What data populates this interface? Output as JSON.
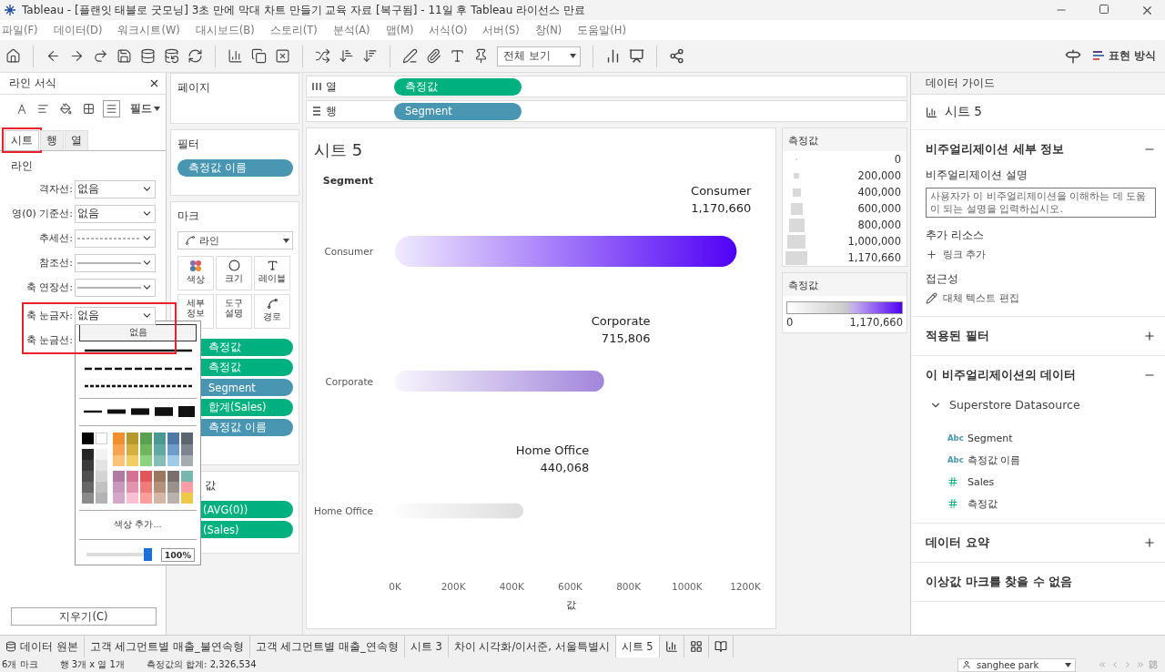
{
  "window": {
    "title": "Tableau - [플랜잇 태블로 굿모닝] 3초 만에 막대 차트 만들기 교육 자료 [복구됨] - 11일 후 Tableau 라이선스 만료"
  },
  "menu": [
    "파일(F)",
    "데이터(D)",
    "워크시트(W)",
    "대시보드(B)",
    "스토리(T)",
    "분석(A)",
    "맵(M)",
    "서식(O)",
    "서버(S)",
    "창(N)",
    "도움말(H)"
  ],
  "toolbar": {
    "fit": "전체 보기",
    "show_me": "표현 방식"
  },
  "format_pane": {
    "title": "라인 서식",
    "fields_button": "필드",
    "tabs": [
      {
        "label": "시트",
        "selected": true,
        "highlighted": true
      },
      {
        "label": "행",
        "selected": false,
        "highlighted": false
      },
      {
        "label": "열",
        "selected": false,
        "highlighted": false
      }
    ],
    "section": "라인",
    "rows": [
      {
        "label": "격자선:",
        "kind": "text",
        "value": "없음",
        "highlighted": false
      },
      {
        "label": "영(0) 기준선:",
        "kind": "text",
        "value": "없음",
        "highlighted": false
      },
      {
        "label": "추세선:",
        "kind": "dashed",
        "highlighted": false
      },
      {
        "label": "참조선:",
        "kind": "solid",
        "highlighted": false
      },
      {
        "label": "축 연장선:",
        "kind": "solid",
        "highlighted": false
      },
      {
        "label": "축 눈금자:",
        "kind": "text",
        "value": "없음",
        "highlighted": true
      },
      {
        "label": "축 눈금선:",
        "kind": "covered",
        "highlighted": true
      }
    ],
    "clear_button": "지우기(C)"
  },
  "line_popup": {
    "options": [
      {
        "kind": "text",
        "label": "없음",
        "selected": true
      },
      {
        "kind": "solid",
        "selected": false
      },
      {
        "kind": "dashed",
        "selected": false
      },
      {
        "kind": "dotted",
        "selected": false
      }
    ],
    "palette": [
      {
        "colors": [
          {
            "color": "#000000"
          },
          {
            "color": "#262626"
          },
          {
            "color": "#3b3b3b"
          },
          {
            "color": "#4f4f4f"
          },
          {
            "color": "#666666"
          },
          {
            "color": "#8a8a8a"
          }
        ]
      },
      {
        "colors": [
          {
            "color": "#ffffff"
          },
          {
            "color": "#f2f2f2"
          },
          {
            "color": "#e3e3e3"
          },
          {
            "color": "#d4d4d4"
          },
          {
            "color": "#c2c2c2"
          },
          {
            "color": "#b3b3b3"
          }
        ]
      },
      {
        "colors": [
          {
            "color": "#f28e2b"
          },
          {
            "color": "#f8a553"
          },
          {
            "color": "#fcc27a"
          },
          {
            "color": "#b07aa1"
          },
          {
            "color": "#c897be"
          },
          {
            "color": "#d4a6c8"
          }
        ]
      },
      {
        "colors": [
          {
            "color": "#b6992d"
          },
          {
            "color": "#d4b13e"
          },
          {
            "color": "#f1ce63"
          },
          {
            "color": "#d37295"
          },
          {
            "color": "#e393ad"
          },
          {
            "color": "#fabfd2"
          }
        ]
      },
      {
        "colors": [
          {
            "color": "#59a14f"
          },
          {
            "color": "#6fb65c"
          },
          {
            "color": "#8cd17d"
          },
          {
            "color": "#e15759"
          },
          {
            "color": "#ef7b7b"
          },
          {
            "color": "#ff9d9a"
          }
        ]
      },
      {
        "colors": [
          {
            "color": "#499894"
          },
          {
            "color": "#5fa9a2"
          },
          {
            "color": "#86bcb6"
          },
          {
            "color": "#9d7660"
          },
          {
            "color": "#b5917b"
          },
          {
            "color": "#d7b5a6"
          }
        ]
      },
      {
        "colors": [
          {
            "color": "#4e79a7"
          },
          {
            "color": "#6f9ccb"
          },
          {
            "color": "#a0cbe8"
          },
          {
            "color": "#79706e"
          },
          {
            "color": "#9a908c"
          },
          {
            "color": "#bab0ac"
          }
        ]
      },
      {
        "colors": [
          {
            "color": "#5b6570"
          },
          {
            "color": "#7b848f"
          },
          {
            "color": "#a5acaf"
          },
          {
            "color": "#76b7b2"
          },
          {
            "color": "#ff9da7"
          },
          {
            "color": "#edc948"
          }
        ]
      }
    ],
    "add_color": "색상 추가...",
    "opacity": {
      "level": 1,
      "reading": "100%"
    }
  },
  "pages": {
    "title": "페이지"
  },
  "filters": {
    "title": "필터",
    "pills": [
      {
        "label": "측정값 이름",
        "kind": "dimension"
      }
    ]
  },
  "marks": {
    "title": "마크",
    "mark_type": "라인",
    "buttons": [
      {
        "label": "색상",
        "kind": "color"
      },
      {
        "label": "크기",
        "kind": "size"
      },
      {
        "label": "레이블",
        "kind": "label"
      },
      {
        "label": "세부 정보",
        "kind": "detail"
      },
      {
        "label": "도구 설명",
        "kind": "tooltip"
      },
      {
        "label": "경로",
        "kind": "path"
      }
    ],
    "pills": [
      {
        "label": "측정값",
        "kind": "measure"
      },
      {
        "label": "측정값",
        "kind": "measure"
      },
      {
        "label": "Segment",
        "kind": "dimension"
      },
      {
        "label": "합계(Sales)",
        "kind": "measure"
      },
      {
        "label": "측정값 이름",
        "kind": "dimension"
      }
    ]
  },
  "measure_values": {
    "title": "값",
    "pills": [
      {
        "label": "(AVG(0))",
        "kind": "measure"
      },
      {
        "label": "(Sales)",
        "kind": "measure"
      }
    ]
  },
  "columns_shelf": {
    "label": "열",
    "pills": [
      {
        "label": "측정값",
        "kind": "measure"
      }
    ]
  },
  "rows_shelf": {
    "label": "행",
    "pills": [
      {
        "label": "Segment",
        "kind": "dimension"
      }
    ]
  },
  "view": {
    "title": "시트 5",
    "chart_data": {
      "type": "bar",
      "orientation": "horizontal",
      "ylabel": "Segment",
      "xlabel": "값",
      "categories": [
        "Consumer",
        "Corporate",
        "Home Office"
      ],
      "values": [
        1170000,
        716000,
        440000
      ],
      "xlim": [
        0,
        1200000
      ],
      "xticks": [
        {
          "value": 0,
          "label": "0K"
        },
        {
          "value": 200000,
          "label": "200K"
        },
        {
          "value": 400000,
          "label": "400K"
        },
        {
          "value": 600000,
          "label": "600K"
        },
        {
          "value": 800000,
          "label": "800K"
        },
        {
          "value": 1000000,
          "label": "1000K"
        },
        {
          "value": 1200000,
          "label": "1200K"
        }
      ],
      "value_labels": [
        {
          "name": "Consumer",
          "value": "1,170,660"
        },
        {
          "name": "Corporate",
          "value": "715,806"
        },
        {
          "name": "Home Office",
          "value": "440,068"
        }
      ]
    }
  },
  "size_legend": {
    "title": "측정값",
    "items": [
      "0",
      "200,000",
      "400,000",
      "600,000",
      "800,000",
      "1,000,000",
      "1,170,660"
    ]
  },
  "color_legend": {
    "title": "측정값",
    "min": "0",
    "max": "1,170,660"
  },
  "data_guide": {
    "title": "데이터 가이드",
    "sheet": "시트 5",
    "sections": [
      {
        "kind": "details",
        "title": "비주얼리제이션 세부 정보",
        "expanded": true,
        "desc_label": "비주얼리제이션 설명",
        "desc_placeholder": "사용자가 이 비주얼리제이션을 이해하는 데 도움이 되는 설명을 입력하십시오.",
        "resources_label": "추가 리소스",
        "add_link": "링크 추가",
        "access_label": "접근성",
        "alt_text": "대체 텍스트 편집"
      },
      {
        "kind": "plain",
        "title": "적용된 필터",
        "expanded": false
      },
      {
        "kind": "data",
        "title": "이 비주얼리제이션의 데이터",
        "expanded": true,
        "source": "Superstore Datasource",
        "fields": [
          {
            "kind": "string",
            "type_label": "Abc",
            "name": "Segment"
          },
          {
            "kind": "string",
            "type_label": "Abc",
            "name": "측정값 이름"
          },
          {
            "kind": "number",
            "name": "Sales"
          },
          {
            "kind": "number",
            "name": "측정값"
          }
        ]
      },
      {
        "kind": "plain",
        "title": "데이터 요약",
        "expanded": false
      },
      {
        "kind": "note",
        "title": "이상값 마크를 찾을 수 없음"
      }
    ]
  },
  "sheet_tabs": {
    "data_source": "데이터 원본",
    "sheets": [
      {
        "label": "고객 세그먼트별 매출_불연속형",
        "selected": false
      },
      {
        "label": "고객 세그먼트별 매출_연속형",
        "selected": false
      },
      {
        "label": "시트 3",
        "selected": false
      },
      {
        "label": "차이 시각화/이서준, 서울특별시",
        "selected": false
      },
      {
        "label": "시트 5",
        "selected": true
      }
    ]
  },
  "status_bar": {
    "marks": "6개 마크",
    "shape": "행 3개 x 열 1개",
    "sum": "측정값의 합계: 2,326,534",
    "user": "sanghee park"
  }
}
